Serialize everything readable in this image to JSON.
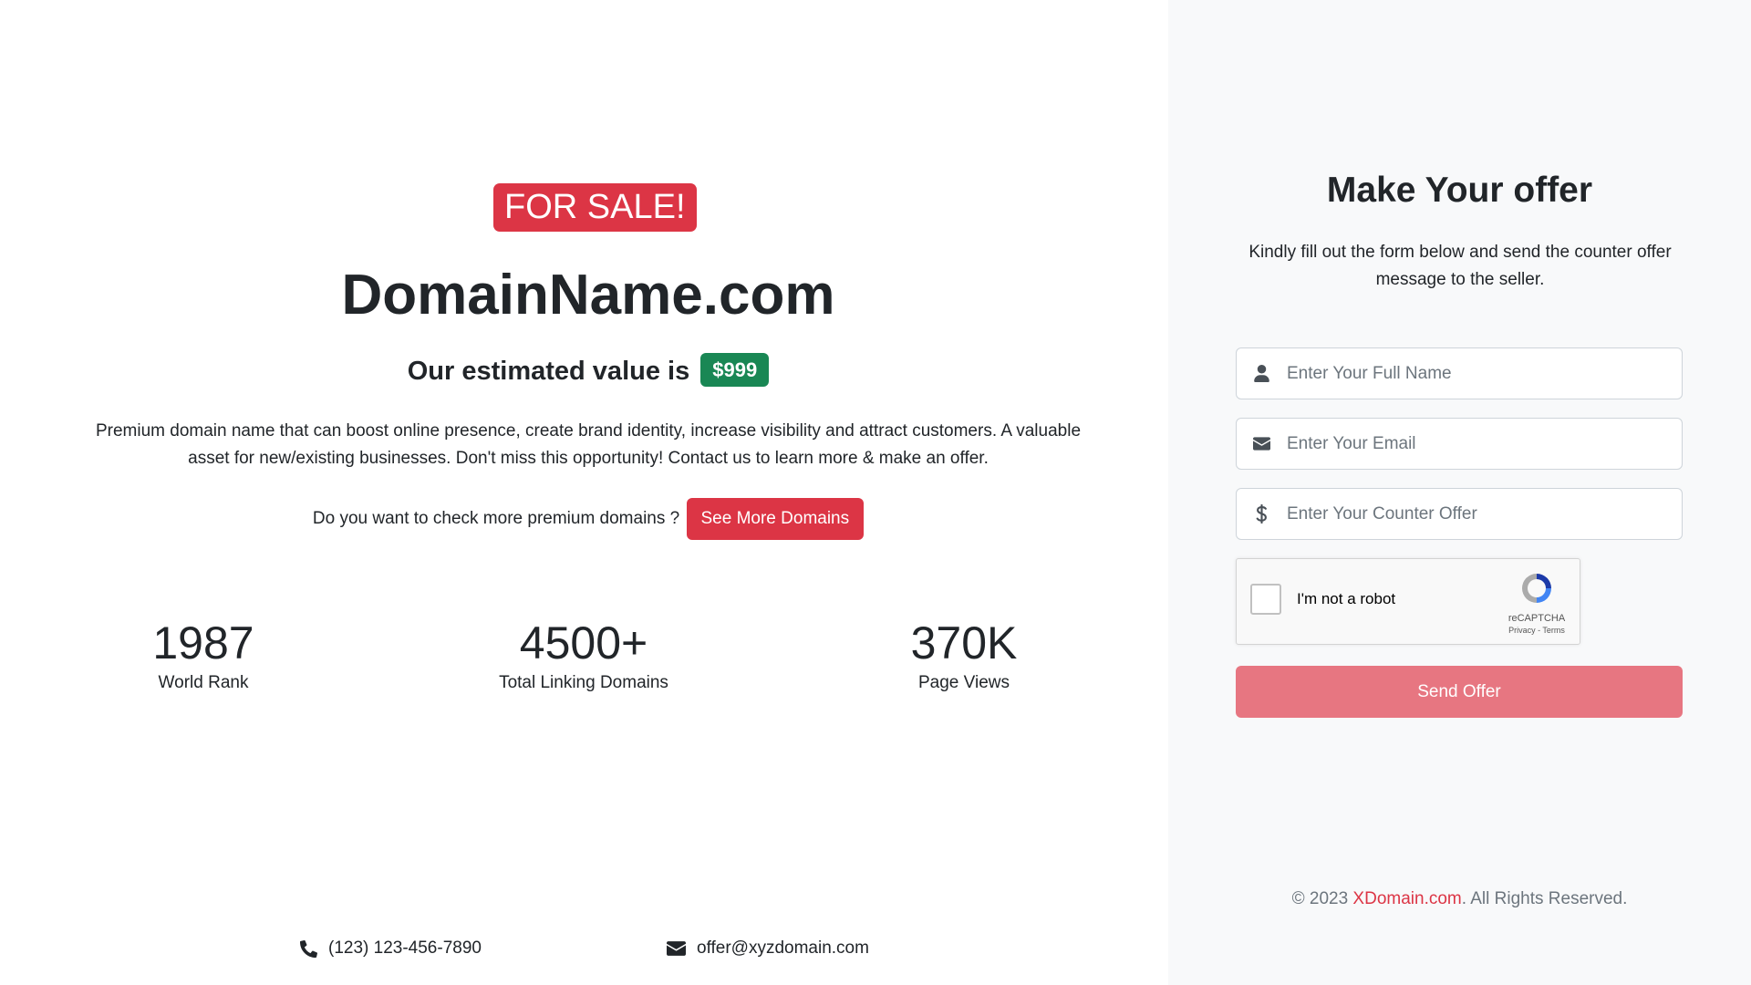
{
  "hero": {
    "badge": "FOR SALE!",
    "domain": "DomainName.com",
    "estimate_label": "Our estimated value is",
    "estimate_value": "$999",
    "description": "Premium domain name that can boost online presence, create brand identity, increase visibility and attract customers. A valuable asset for new/existing businesses. Don't miss this opportunity! Contact us to learn more & make an offer.",
    "more_question": "Do you want to check more premium domains ?",
    "more_button": "See More Domains"
  },
  "stats": [
    {
      "value": "1987",
      "label": "World Rank"
    },
    {
      "value": "4500+",
      "label": "Total Linking Domains"
    },
    {
      "value": "370K",
      "label": "Page Views"
    }
  ],
  "contact": {
    "phone": "(123) 123-456-7890",
    "email": "offer@xyzdomain.com"
  },
  "offer": {
    "title": "Make Your offer",
    "subtitle": "Kindly fill out the form below and send the counter offer message to the seller.",
    "name_placeholder": "Enter Your Full Name",
    "email_placeholder": "Enter Your Email",
    "offer_placeholder": "Enter Your Counter Offer",
    "captcha_label": "I'm not a robot",
    "captcha_brand": "reCAPTCHA",
    "captcha_links": "Privacy - Terms",
    "send_button": "Send Offer"
  },
  "footer": {
    "copyright_prefix": "© 2023",
    "brand": "XDomain.com",
    "copyright_suffix": ". All Rights Reserved."
  },
  "colors": {
    "danger": "#dc3545",
    "success": "#198754",
    "panel_bg": "#f8f9fa",
    "send_button": "#e77681"
  },
  "icons": [
    "user-icon",
    "envelope-icon",
    "dollar-icon",
    "phone-icon",
    "recaptcha-icon"
  ]
}
